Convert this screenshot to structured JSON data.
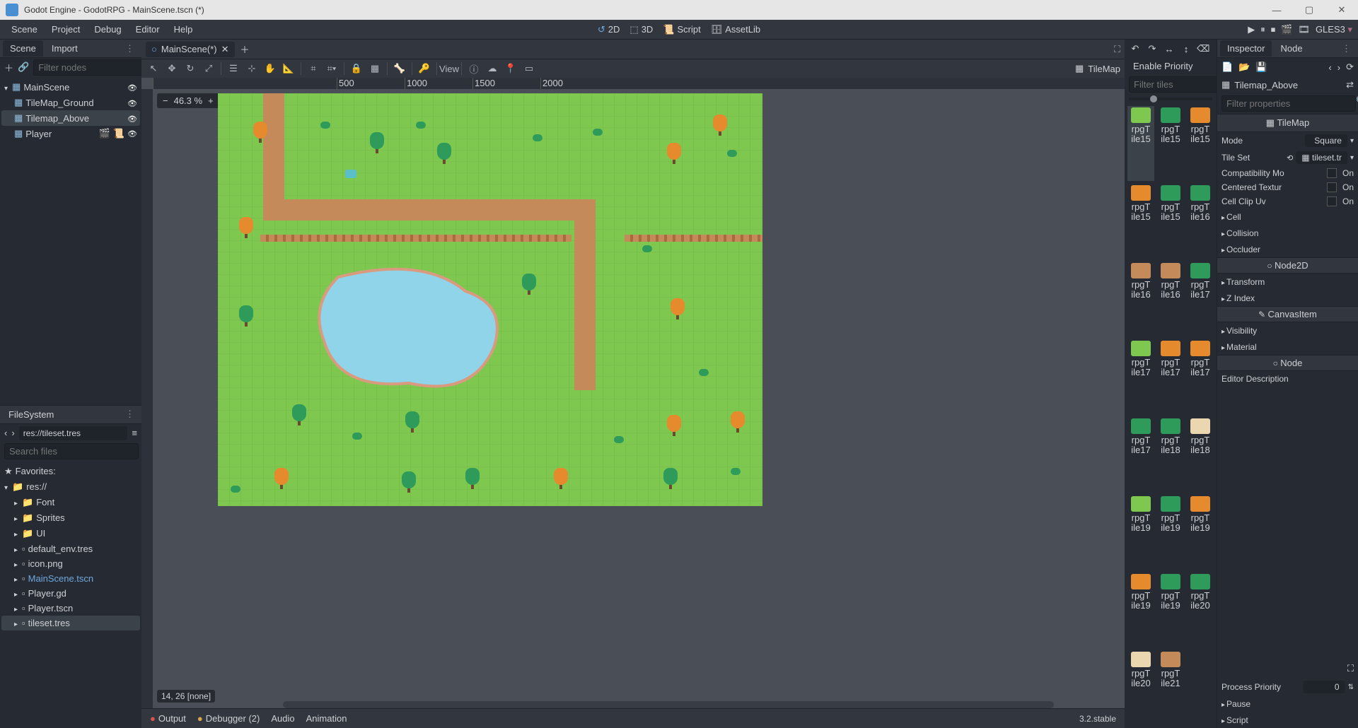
{
  "title": "Godot Engine - GodotRPG - MainScene.tscn (*)",
  "menubar": {
    "items": [
      "Scene",
      "Project",
      "Debug",
      "Editor",
      "Help"
    ],
    "center": [
      {
        "k": "2d",
        "l": "2D"
      },
      {
        "k": "3d",
        "l": "3D"
      },
      {
        "k": "script",
        "l": "Script"
      },
      {
        "k": "assetlib",
        "l": "AssetLib"
      }
    ],
    "gles": "GLES3"
  },
  "scene_dock": {
    "tabs": [
      "Scene",
      "Import"
    ],
    "filter_placeholder": "Filter nodes",
    "tree": [
      {
        "lvl": 0,
        "name": "MainScene",
        "icon": "node2d",
        "sel": false
      },
      {
        "lvl": 1,
        "name": "TileMap_Ground",
        "icon": "tilemap",
        "sel": false
      },
      {
        "lvl": 1,
        "name": "Tilemap_Above",
        "icon": "tilemap",
        "sel": true
      },
      {
        "lvl": 1,
        "name": "Player",
        "icon": "kinematic",
        "sel": false,
        "extra": true
      }
    ]
  },
  "filesystem": {
    "header": "FileSystem",
    "path": "res://tileset.tres",
    "search_placeholder": "Search files",
    "favorites": "Favorites:",
    "tree": [
      {
        "lvl": 0,
        "name": "res://",
        "icon": "folder",
        "open": true
      },
      {
        "lvl": 1,
        "name": "Font",
        "icon": "folder"
      },
      {
        "lvl": 1,
        "name": "Sprites",
        "icon": "folder"
      },
      {
        "lvl": 1,
        "name": "UI",
        "icon": "folder"
      },
      {
        "lvl": 1,
        "name": "default_env.tres",
        "icon": "env"
      },
      {
        "lvl": 1,
        "name": "icon.png",
        "icon": "img"
      },
      {
        "lvl": 1,
        "name": "MainScene.tscn",
        "icon": "scene",
        "blue": true
      },
      {
        "lvl": 1,
        "name": "Player.gd",
        "icon": "gd"
      },
      {
        "lvl": 1,
        "name": "Player.tscn",
        "icon": "scene"
      },
      {
        "lvl": 1,
        "name": "tileset.tres",
        "icon": "res",
        "sel": true
      }
    ]
  },
  "scenetabs": {
    "tab": "MainScene(*)"
  },
  "viewport": {
    "zoom": "46.3 %",
    "coord": "14, 26 [none]",
    "view_label": "View",
    "ruler": [
      "500",
      "1000",
      "1500",
      "2000"
    ],
    "tilemap_label": "TileMap"
  },
  "tile_palette": {
    "enable_priority": "Enable Priority",
    "filter_placeholder": "Filter tiles",
    "tiles": [
      {
        "n": "rpgTile15",
        "c": "#7ec850",
        "sel": true
      },
      {
        "n": "rpgTile15",
        "c": "#2e9b5b"
      },
      {
        "n": "rpgTile15",
        "c": "#e68a2e"
      },
      {
        "n": "rpgTile15",
        "c": "#e68a2e"
      },
      {
        "n": "rpgTile15",
        "c": "#2e9b5b"
      },
      {
        "n": "rpgTile16",
        "c": "#2e9b5b"
      },
      {
        "n": "rpgTile16",
        "c": "#c48a5a"
      },
      {
        "n": "rpgTile16",
        "c": "#c48a5a"
      },
      {
        "n": "rpgTile17",
        "c": "#2e9b5b"
      },
      {
        "n": "rpgTile17",
        "c": "#7ec850"
      },
      {
        "n": "rpgTile17",
        "c": "#e68a2e"
      },
      {
        "n": "rpgTile17",
        "c": "#e68a2e"
      },
      {
        "n": "rpgTile17",
        "c": "#2e9b5b"
      },
      {
        "n": "rpgTile18",
        "c": "#2e9b5b"
      },
      {
        "n": "rpgTile18",
        "c": "#ead7b0"
      },
      {
        "n": "rpgTile19",
        "c": "#7ec850"
      },
      {
        "n": "rpgTile19",
        "c": "#2e9b5b"
      },
      {
        "n": "rpgTile19",
        "c": "#e68a2e"
      },
      {
        "n": "rpgTile19",
        "c": "#e68a2e"
      },
      {
        "n": "rpgTile19",
        "c": "#2e9b5b"
      },
      {
        "n": "rpgTile20",
        "c": "#2e9b5b"
      },
      {
        "n": "rpgTile20",
        "c": "#ead7b0"
      },
      {
        "n": "rpgTile21",
        "c": "#c48a5a"
      },
      {
        "n": "",
        "c": "transparent"
      }
    ]
  },
  "inspector": {
    "tabs": [
      "Inspector",
      "Node"
    ],
    "obj": "Tilemap_Above",
    "filter_placeholder": "Filter properties",
    "class_tilemap": "TileMap",
    "class_node2d": "Node2D",
    "class_canvasitem": "CanvasItem",
    "class_node": "Node",
    "rows": [
      {
        "k": "Mode",
        "v": "Square",
        "type": "dd"
      },
      {
        "k": "Tile Set",
        "v": "tileset.tr",
        "type": "res"
      },
      {
        "k": "Compatibility Mo",
        "v": "On",
        "type": "chk"
      },
      {
        "k": "Centered Textur",
        "v": "On",
        "type": "chk"
      },
      {
        "k": "Cell Clip Uv",
        "v": "On",
        "type": "chk"
      }
    ],
    "sections_cell": [
      "Cell",
      "Collision",
      "Occluder"
    ],
    "sections_n2d": [
      "Transform",
      "Z Index"
    ],
    "sections_ci": [
      "Visibility",
      "Material"
    ],
    "editor_desc": "Editor Description",
    "process_priority_k": "Process Priority",
    "process_priority_v": "0",
    "sections_node": [
      "Pause",
      "Script"
    ]
  },
  "bottom": {
    "output": "Output",
    "debugger": "Debugger (2)",
    "audio": "Audio",
    "animation": "Animation",
    "version": "3.2.stable"
  }
}
